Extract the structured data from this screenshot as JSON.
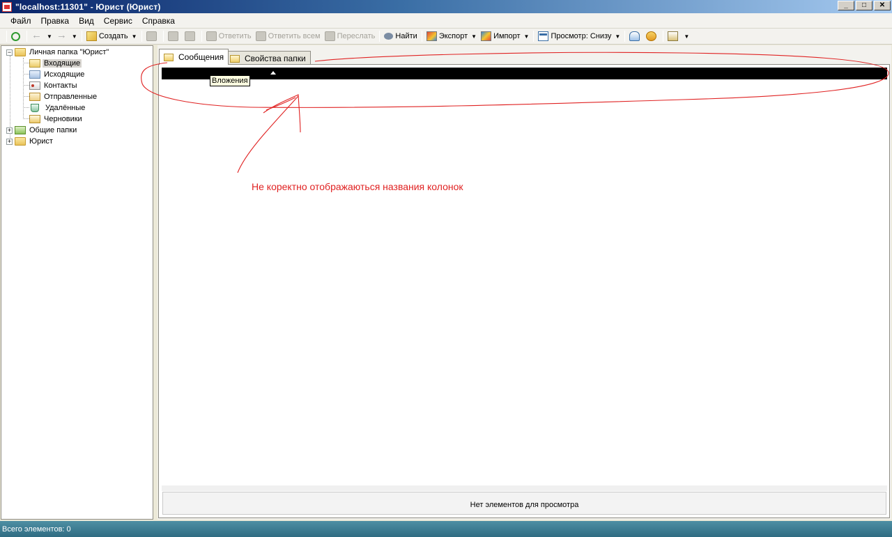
{
  "window": {
    "title": "\"localhost:11301\" - Юрист (Юрист)",
    "controls": [
      "_",
      "□",
      "✕"
    ]
  },
  "menu": [
    "Файл",
    "Правка",
    "Вид",
    "Сервис",
    "Справка"
  ],
  "toolbar": {
    "create": "Создать",
    "reply": "Ответить",
    "reply_all": "Ответить всем",
    "forward": "Переслать",
    "find": "Найти",
    "export": "Экспорт",
    "import": "Импорт",
    "view": "Просмотр: Снизу"
  },
  "tree": {
    "root": "Личная папка \"Юрист\"",
    "children": [
      "Входящие",
      "Исходящие",
      "Контакты",
      "Отправленные",
      "Удалённые",
      "Черновики"
    ],
    "selected": "Входящие",
    "shared": "Общие папки",
    "user": "Юрист"
  },
  "tabs": {
    "messages": "Сообщения",
    "folder_properties": "Свойства папки"
  },
  "grid": {
    "tooltip": "Вложения",
    "empty_text": "Нет элементов для просмотра"
  },
  "annotation": {
    "text": "Не коректно отображаються названия колонок",
    "color": "#e02222"
  },
  "status": {
    "total": "Всего элементов: 0"
  }
}
